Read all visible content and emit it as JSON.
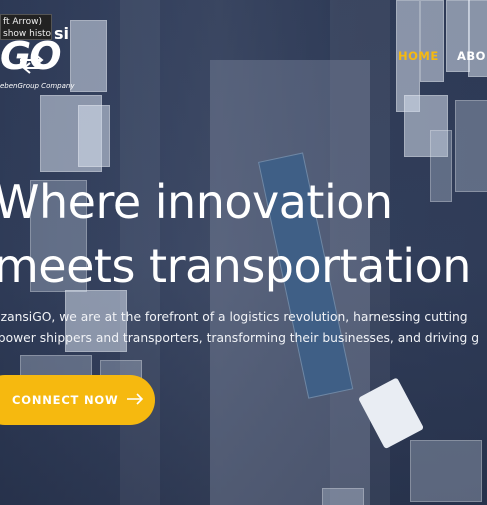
{
  "tooltip": {
    "line1": "ft Arrow)",
    "line2": "show history"
  },
  "logo": {
    "mark_left": "GO",
    "mark_top": "si",
    "subtitle": "ebenGroup Company"
  },
  "nav": {
    "home": "HOME",
    "about": "ABOU"
  },
  "hero": {
    "headline_line1": "Where innovation",
    "headline_line2": "meets transportation",
    "subtext_line1": "MzansiGO, we are at the forefront of a logistics revolution, harnessing cutting",
    "subtext_line2": "npower shippers and transporters, transforming their businesses, and driving g",
    "cta_label": "CONNECT NOW"
  },
  "colors": {
    "accent": "#f6b90f",
    "overlay": "#2d3a56",
    "text": "#ffffff"
  },
  "icons": {
    "cta": "arrow-right-icon"
  }
}
